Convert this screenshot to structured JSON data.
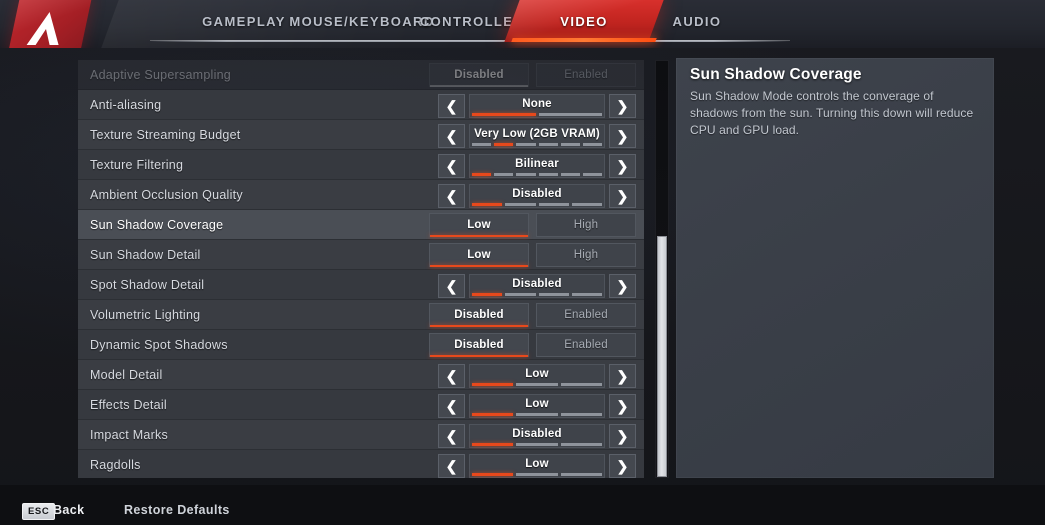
{
  "app": {
    "logo_icon": "apex-legends-logo",
    "accent_red": "#c0241f",
    "accent_orange": "#e8491c",
    "row_bg": "#3a3d43",
    "selected_row_bg": "#4a4e55"
  },
  "tabs": [
    {
      "label": "GAMEPLAY",
      "active": false
    },
    {
      "label": "MOUSE/KEYBOARD",
      "active": false
    },
    {
      "label": "CONTROLLER",
      "active": false
    },
    {
      "label": "VIDEO",
      "active": true
    },
    {
      "label": "AUDIO",
      "active": false
    }
  ],
  "settings": [
    {
      "label": "Adaptive Supersampling",
      "type": "toggle",
      "options": [
        "Disabled",
        "Enabled"
      ],
      "selected_index": 0,
      "ghost": true,
      "selected": false
    },
    {
      "label": "Anti-aliasing",
      "type": "stepper",
      "value": "None",
      "segments": 2,
      "segment_index": 0,
      "ghost": false,
      "selected": false
    },
    {
      "label": "Texture Streaming Budget",
      "type": "stepper",
      "value": "Very Low (2GB VRAM)",
      "segments": 6,
      "segment_index": 1,
      "ghost": false,
      "selected": false
    },
    {
      "label": "Texture Filtering",
      "type": "stepper",
      "value": "Bilinear",
      "segments": 6,
      "segment_index": 0,
      "ghost": false,
      "selected": false
    },
    {
      "label": "Ambient Occlusion Quality",
      "type": "stepper",
      "value": "Disabled",
      "segments": 4,
      "segment_index": 0,
      "ghost": false,
      "selected": false
    },
    {
      "label": "Sun Shadow Coverage",
      "type": "toggle",
      "options": [
        "Low",
        "High"
      ],
      "selected_index": 0,
      "ghost": false,
      "selected": true
    },
    {
      "label": "Sun Shadow Detail",
      "type": "toggle",
      "options": [
        "Low",
        "High"
      ],
      "selected_index": 0,
      "ghost": false,
      "selected": false
    },
    {
      "label": "Spot Shadow Detail",
      "type": "stepper",
      "value": "Disabled",
      "segments": 4,
      "segment_index": 0,
      "ghost": false,
      "selected": false
    },
    {
      "label": "Volumetric Lighting",
      "type": "toggle",
      "options": [
        "Disabled",
        "Enabled"
      ],
      "selected_index": 0,
      "ghost": false,
      "selected": false
    },
    {
      "label": "Dynamic Spot Shadows",
      "type": "toggle",
      "options": [
        "Disabled",
        "Enabled"
      ],
      "selected_index": 0,
      "ghost": false,
      "selected": false
    },
    {
      "label": "Model Detail",
      "type": "stepper",
      "value": "Low",
      "segments": 3,
      "segment_index": 0,
      "ghost": false,
      "selected": false
    },
    {
      "label": "Effects Detail",
      "type": "stepper",
      "value": "Low",
      "segments": 3,
      "segment_index": 0,
      "ghost": false,
      "selected": false
    },
    {
      "label": "Impact Marks",
      "type": "stepper",
      "value": "Disabled",
      "segments": 3,
      "segment_index": 0,
      "ghost": false,
      "selected": false
    },
    {
      "label": "Ragdolls",
      "type": "stepper",
      "value": "Low",
      "segments": 3,
      "segment_index": 0,
      "ghost": false,
      "selected": false
    }
  ],
  "scrollbar": {
    "thumb_top_pct": 42,
    "thumb_height_pct": 58
  },
  "description": {
    "title": "Sun Shadow Coverage",
    "body": "Sun Shadow Mode controls the converage of shadows from the sun. Turning this down will reduce CPU and GPU load."
  },
  "footer": {
    "esc_key": "ESC",
    "back_label": "Back",
    "restore_label": "Restore Defaults"
  },
  "icons": {
    "left_arrow": "❮",
    "right_arrow": "❯"
  }
}
